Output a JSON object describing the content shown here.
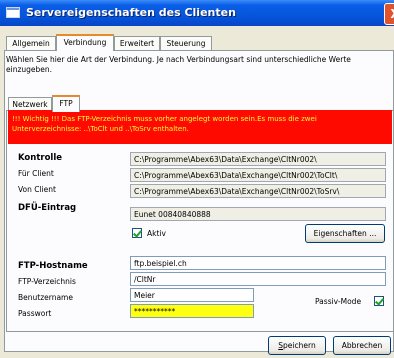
{
  "window": {
    "title": "Servereigenschaften des Clienten",
    "close_glyph": "X"
  },
  "tabs": [
    {
      "label": "Allgemein",
      "active": false
    },
    {
      "label": "Verbindung",
      "active": true
    },
    {
      "label": "Erweitert",
      "active": false
    },
    {
      "label": "Steuerung",
      "active": false
    }
  ],
  "info_text": "Wählen Sie hier die Art der Verbindung. Je nach Verbindungsart sind unterschiedliche Werte einzugeben.",
  "subtabs": [
    {
      "label": "Netzwerk",
      "active": false
    },
    {
      "label": "FTP",
      "active": true
    }
  ],
  "alert": {
    "text": "!!! Wichtig !!! Das FTP-Verzeichnis muss vorher angelegt worden sein.Es muss die zwei Unterverzeichnisse: ..\\ToClt und ..\\ToSrv enthalten.",
    "bg_color": "#ff0a00",
    "text_color": "#ffff30"
  },
  "kontrolle": {
    "label": "Kontrolle",
    "value": "C:\\Programme\\Abex63\\Data\\Exchange\\CltNr002\\"
  },
  "fuer_client": {
    "label": "Für Client",
    "value": "C:\\Programme\\Abex63\\Data\\Exchange\\CltNr002\\ToClt\\"
  },
  "von_client": {
    "label": "Von Client",
    "value": "C:\\Programme\\Abex63\\Data\\Exchange\\CltNr002\\ToSrv\\"
  },
  "dfue": {
    "label": "DFÜ-Eintrag",
    "value": "Eunet 00840840888",
    "aktiv_label": "Aktiv",
    "aktiv_checked": true,
    "eigenschaften_label": "Eigenschaften ..."
  },
  "ftp": {
    "hostname_label": "FTP-Hostname",
    "hostname_value": "ftp.beispiel.ch",
    "verzeichnis_label": "FTP-Verzeichnis",
    "verzeichnis_value": "/CltNr",
    "benutzer_label": "Benutzername",
    "benutzer_value": "Meier",
    "passwort_label": "Passwort",
    "passwort_value": "***********",
    "passiv_label": "Passiv-Mode",
    "passiv_checked": true
  },
  "footer": {
    "speichern_first": "S",
    "speichern_rest": "peichern",
    "abbrechen_label": "Abbrechen"
  }
}
